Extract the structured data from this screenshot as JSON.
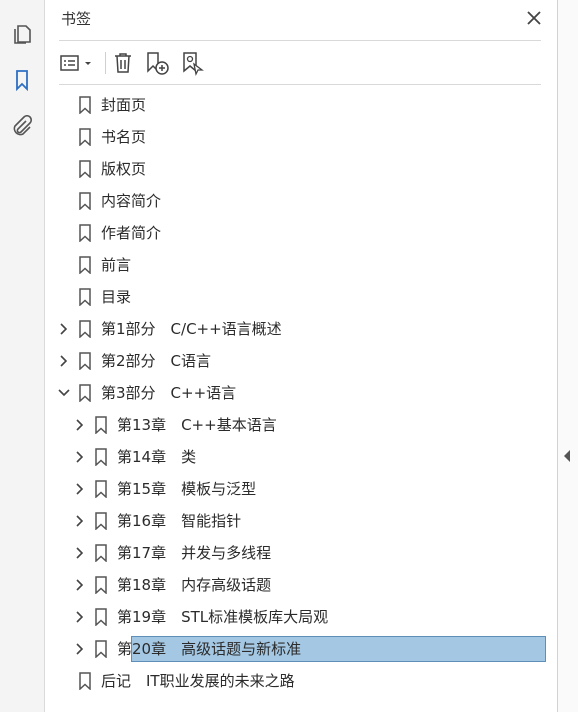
{
  "panel": {
    "title": "书签"
  },
  "sidebar": {
    "icons": [
      "pages-icon",
      "bookmark-icon",
      "attachment-icon"
    ],
    "active": "bookmark-icon",
    "accent_color": "#2d6fc3"
  },
  "toolbar": {
    "buttons": [
      "options-menu-icon",
      "delete-icon",
      "add-bookmark-icon",
      "new-bookmark-from-structure-icon"
    ]
  },
  "selection_color": "#a4c8e4",
  "bookmarks": [
    {
      "label": "封面页",
      "level": 0,
      "expander": "none"
    },
    {
      "label": "书名页",
      "level": 0,
      "expander": "none"
    },
    {
      "label": "版权页",
      "level": 0,
      "expander": "none"
    },
    {
      "label": "内容简介",
      "level": 0,
      "expander": "none"
    },
    {
      "label": "作者简介",
      "level": 0,
      "expander": "none"
    },
    {
      "label": "前言",
      "level": 0,
      "expander": "none"
    },
    {
      "label": "目录",
      "level": 0,
      "expander": "none"
    },
    {
      "label": "第1部分　C/C++语言概述",
      "level": 0,
      "expander": "collapsed"
    },
    {
      "label": "第2部分　C语言",
      "level": 0,
      "expander": "collapsed"
    },
    {
      "label": "第3部分　C++语言",
      "level": 0,
      "expander": "expanded"
    },
    {
      "label": "第13章　C++基本语言",
      "level": 1,
      "expander": "collapsed"
    },
    {
      "label": "第14章　类",
      "level": 1,
      "expander": "collapsed"
    },
    {
      "label": "第15章　模板与泛型",
      "level": 1,
      "expander": "collapsed"
    },
    {
      "label": "第16章　智能指针",
      "level": 1,
      "expander": "collapsed"
    },
    {
      "label": "第17章　并发与多线程",
      "level": 1,
      "expander": "collapsed"
    },
    {
      "label": "第18章　内存高级话题",
      "level": 1,
      "expander": "collapsed"
    },
    {
      "label": "第19章　STL标准模板库大局观",
      "level": 1,
      "expander": "collapsed"
    },
    {
      "label": "第20章　高级话题与新标准",
      "level": 1,
      "expander": "collapsed",
      "selected": true
    },
    {
      "label": "后记　IT职业发展的未来之路",
      "level": 0,
      "expander": "none"
    }
  ]
}
